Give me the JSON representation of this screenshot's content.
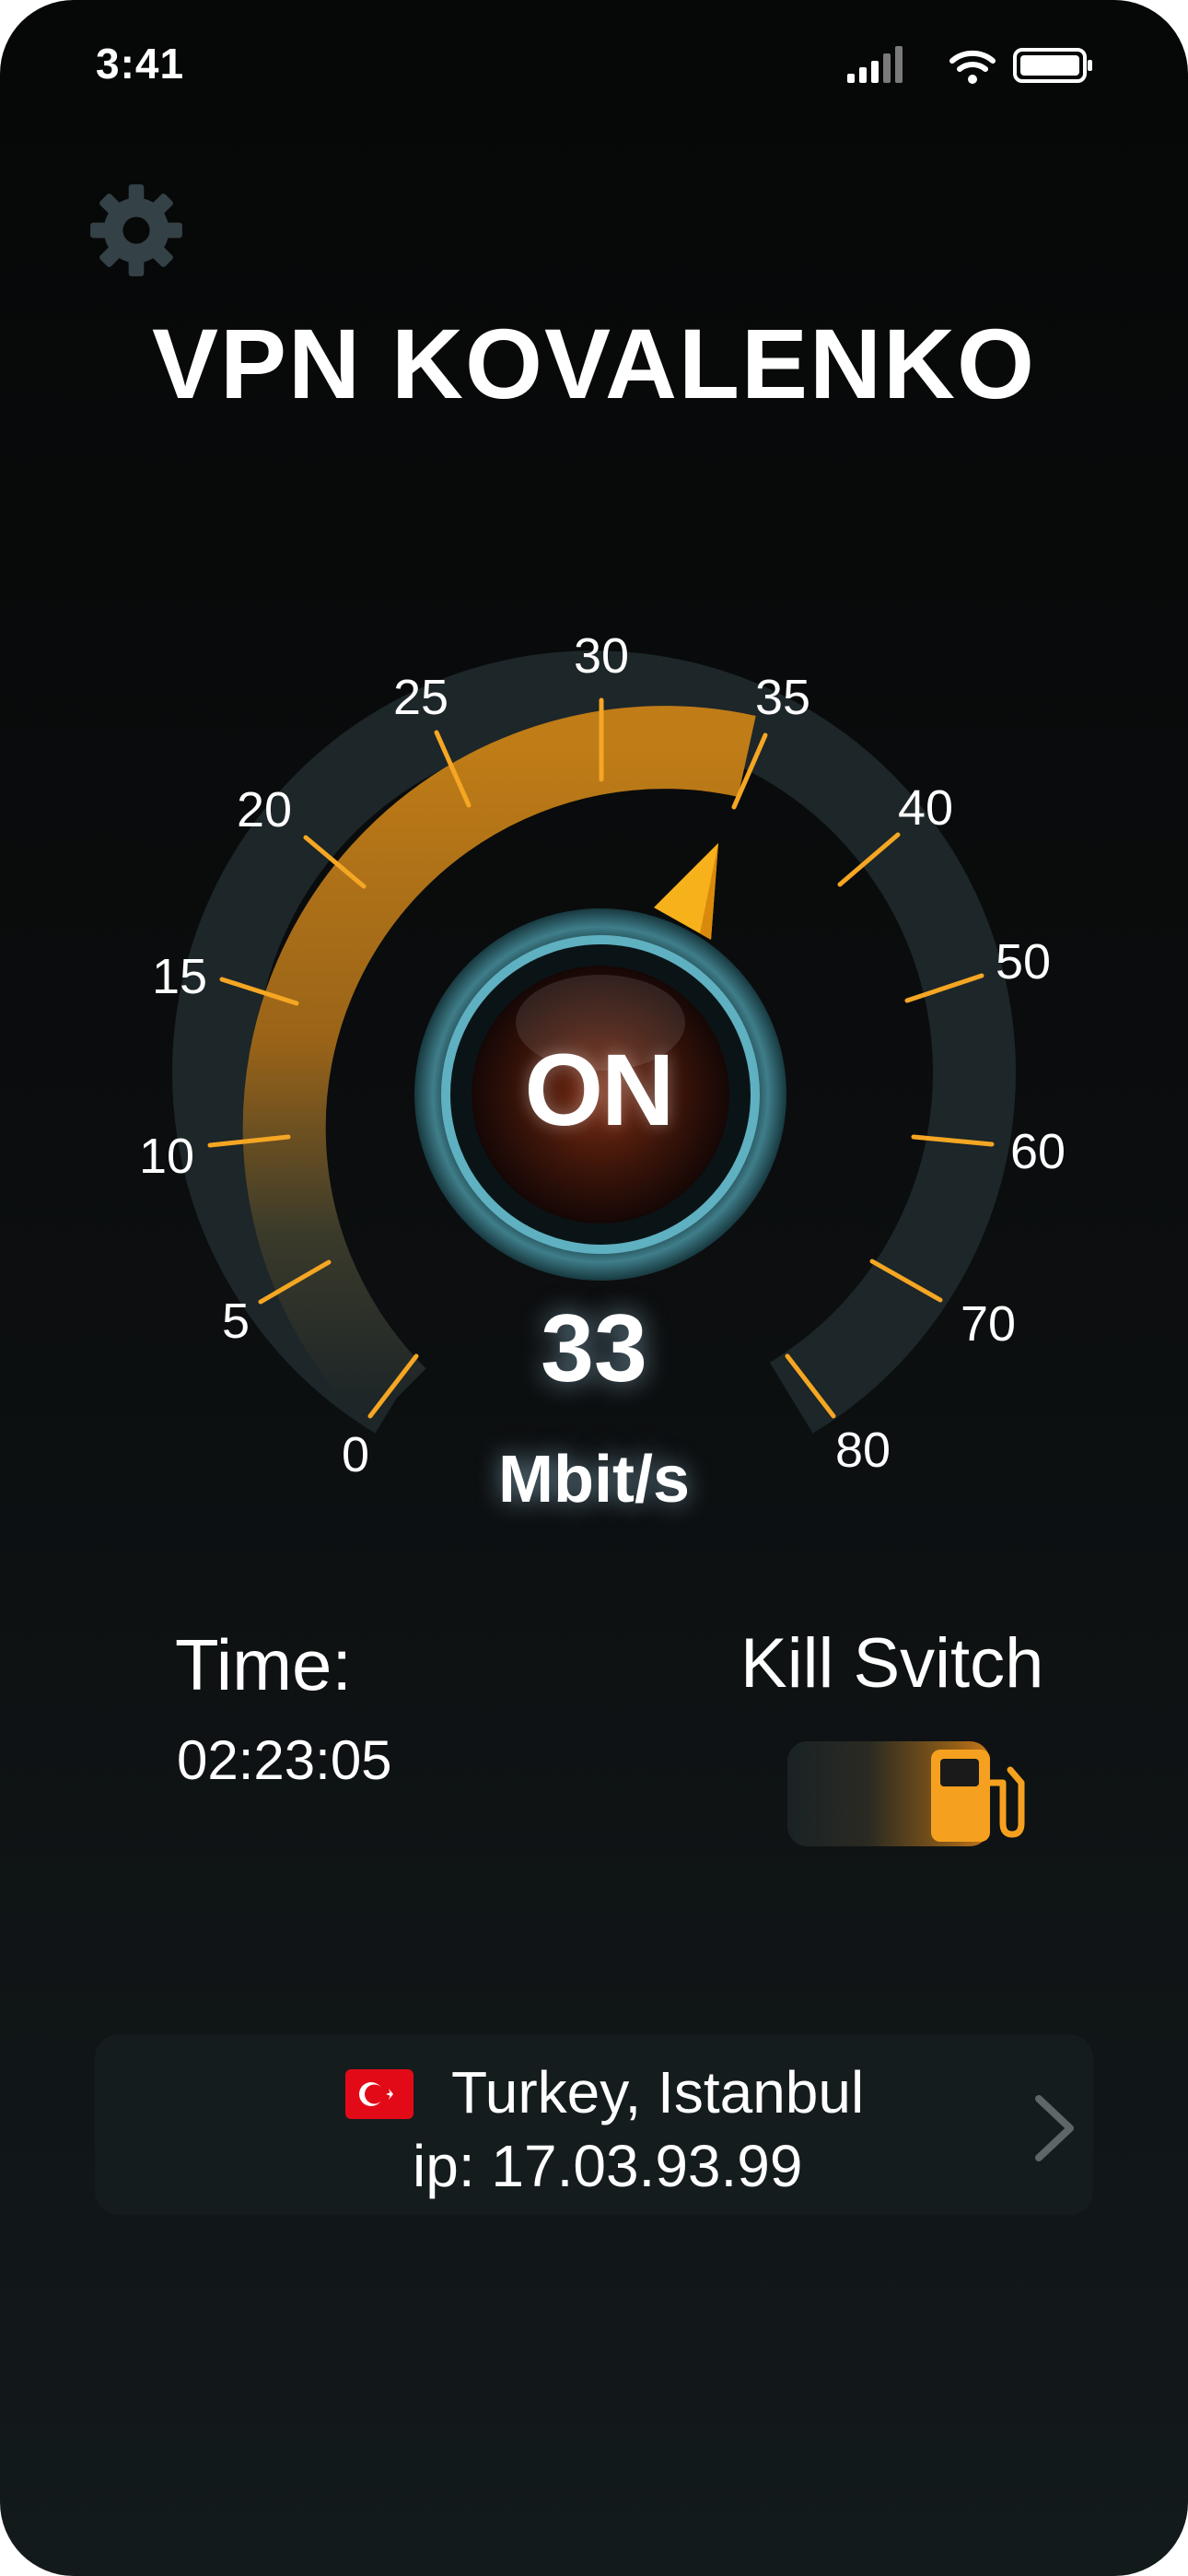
{
  "status_bar": {
    "time": "3:41"
  },
  "app": {
    "title": "VPN KOVALENKO"
  },
  "gauge": {
    "tick_labels": [
      "0",
      "5",
      "10",
      "15",
      "20",
      "25",
      "30",
      "35",
      "40",
      "50",
      "60",
      "70",
      "80"
    ],
    "power_state": "ON",
    "speed": "33",
    "unit": "Mbit/s",
    "accent_color": "#f5a623"
  },
  "session": {
    "time_label": "Time:",
    "time_value": "02:23:05"
  },
  "kill_switch": {
    "label": "Kill Svitch",
    "enabled": true
  },
  "location": {
    "country_city": "Turkey, Istanbul",
    "ip": "ip: 17.03.93.99",
    "flag": "turkey-flag"
  }
}
